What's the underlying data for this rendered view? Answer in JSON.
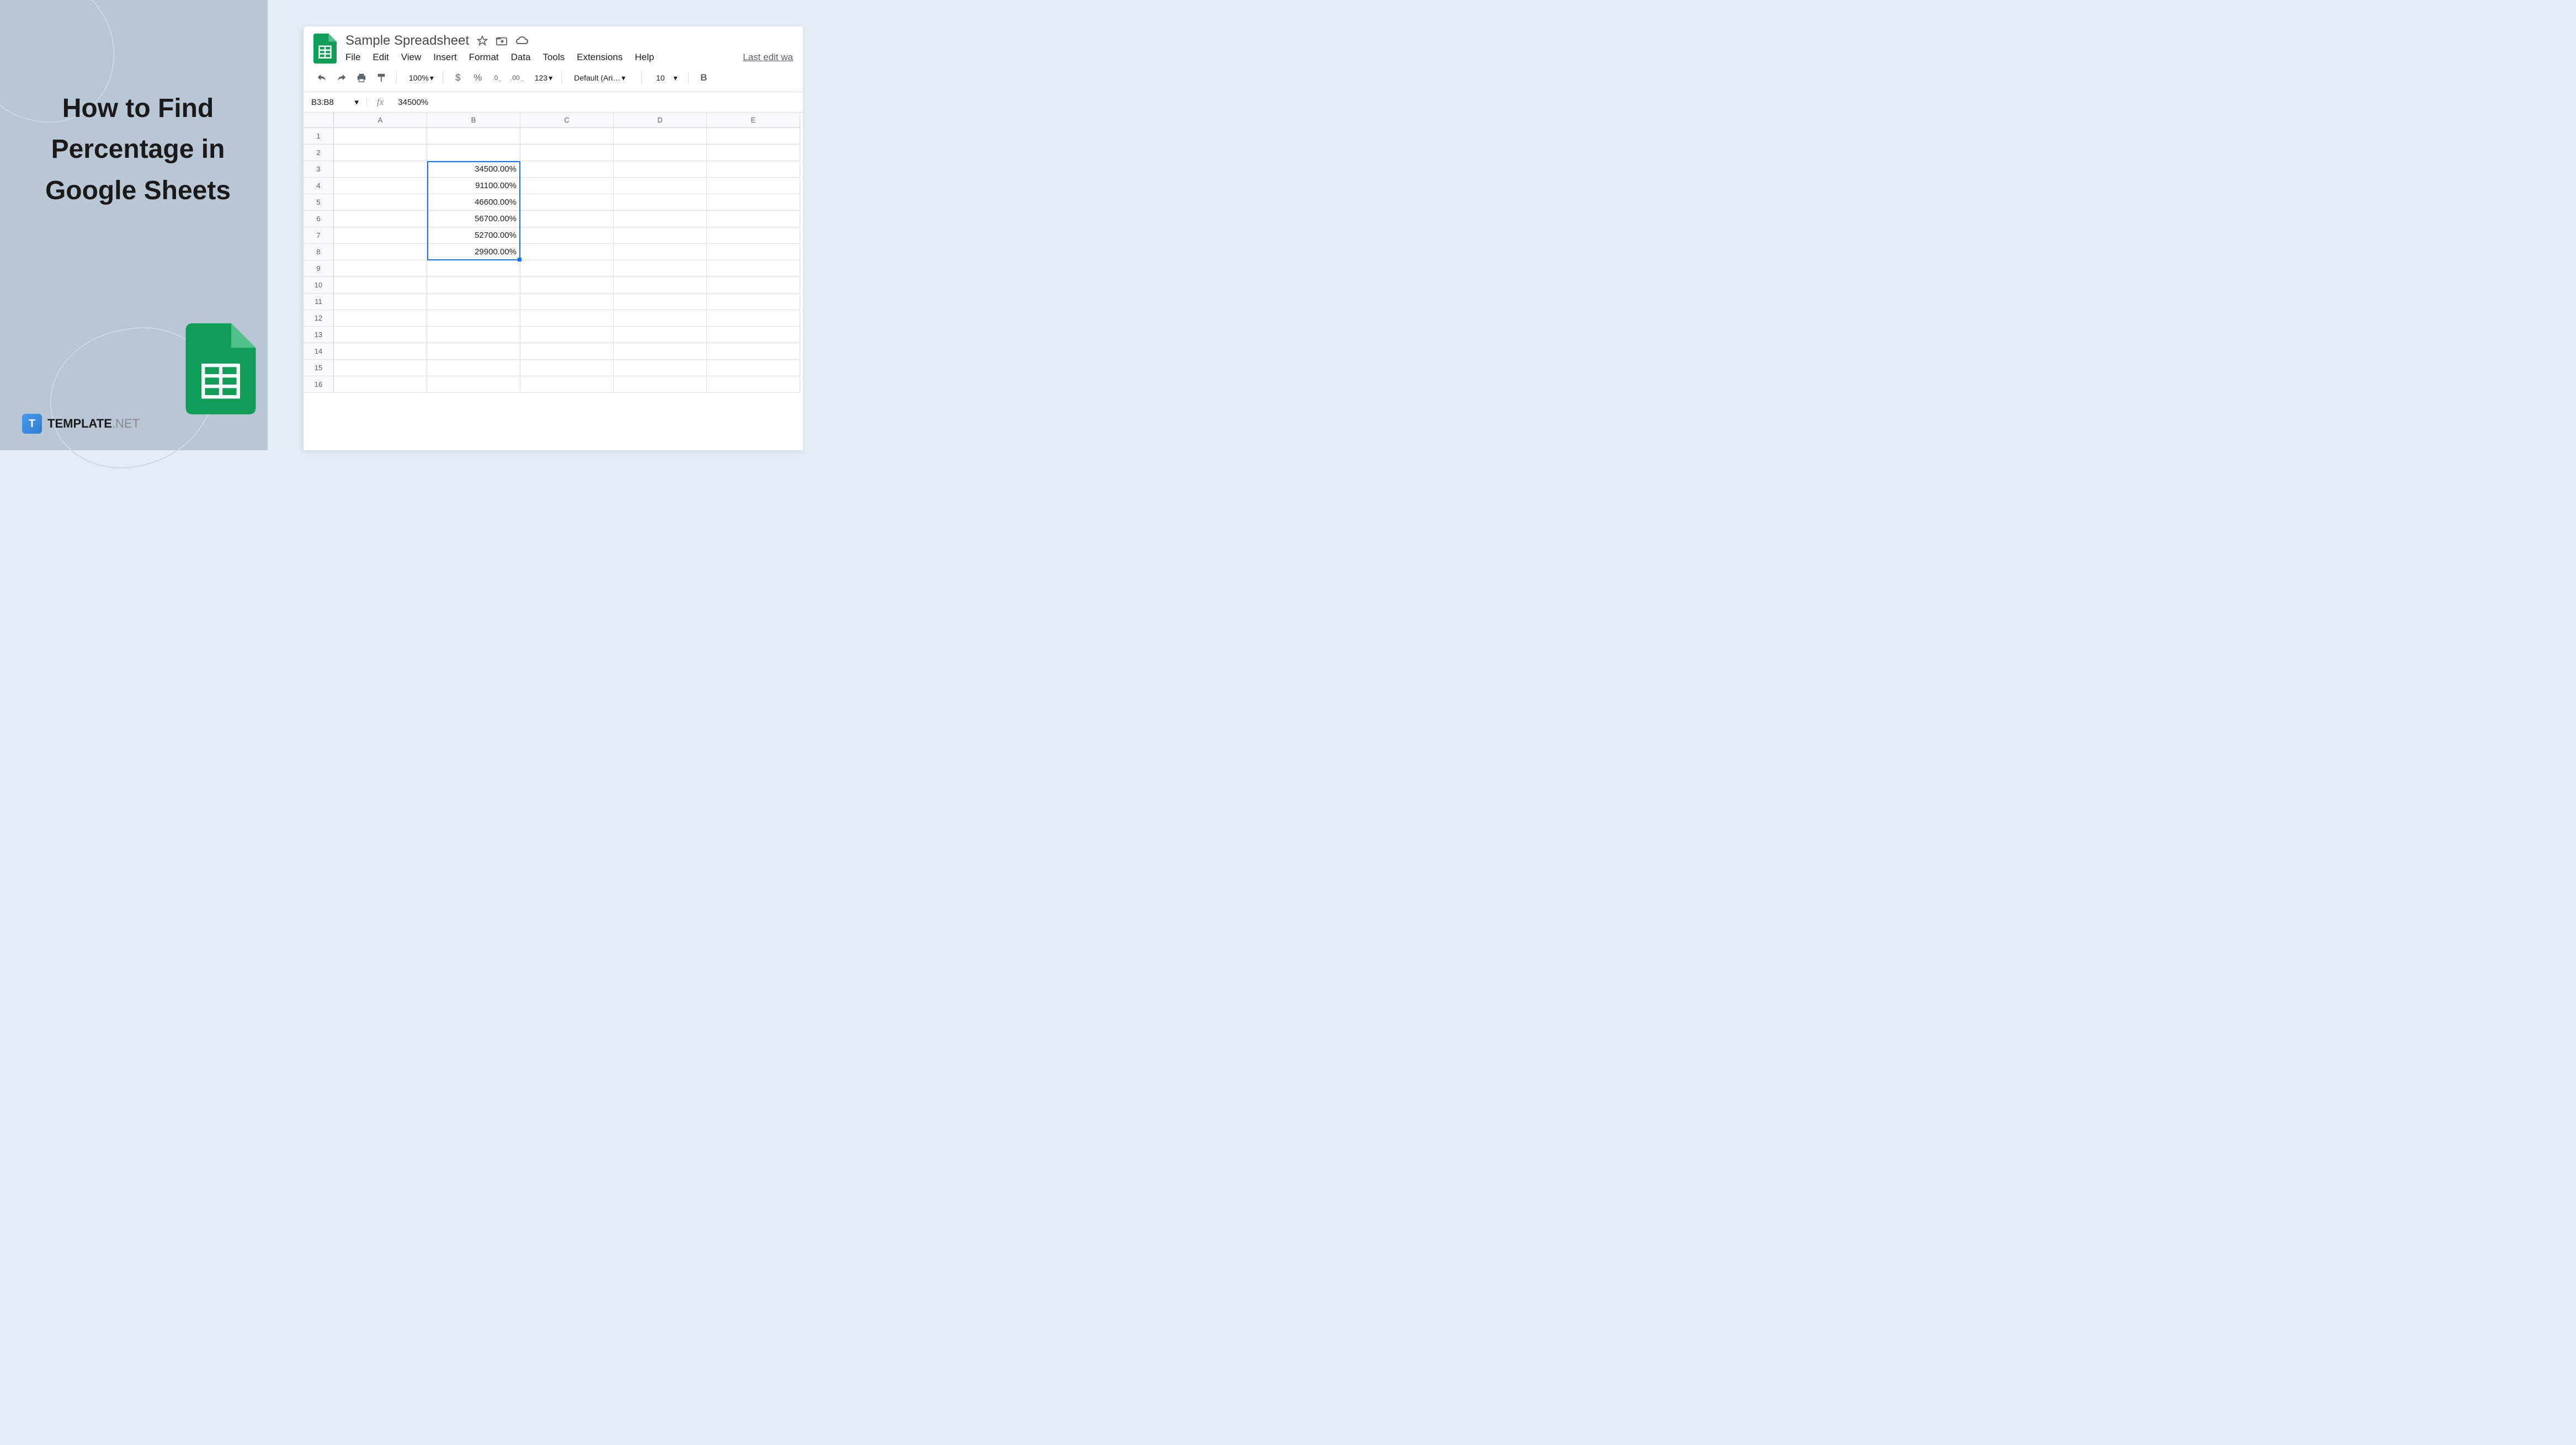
{
  "headline": "How to Find Percentage in Google Sheets",
  "template_logo": {
    "t": "T",
    "brand": "TEMPLATE",
    "suffix": ".NET"
  },
  "doc_title": "Sample Spreadsheet",
  "menu": [
    "File",
    "Edit",
    "View",
    "Insert",
    "Format",
    "Data",
    "Tools",
    "Extensions",
    "Help"
  ],
  "last_edit": "Last edit wa",
  "toolbar": {
    "zoom": "100%",
    "dollar": "$",
    "percent": "%",
    "dec_minus": ".0",
    "dec_plus": ".00",
    "123": "123",
    "font": "Default (Ari…",
    "font_size": "10",
    "bold": "B"
  },
  "name_box": "B3:B8",
  "fx": "fx",
  "formula_value": "34500%",
  "columns": [
    "A",
    "B",
    "C",
    "D",
    "E"
  ],
  "row_numbers": [
    "1",
    "2",
    "3",
    "4",
    "5",
    "6",
    "7",
    "8",
    "9",
    "10",
    "11",
    "12",
    "13",
    "14",
    "15",
    "16"
  ],
  "cells": {
    "B3": "34500.00%",
    "B4": "91100.00%",
    "B5": "46600.00%",
    "B6": "56700.00%",
    "B7": "52700.00%",
    "B8": "29900.00%"
  }
}
